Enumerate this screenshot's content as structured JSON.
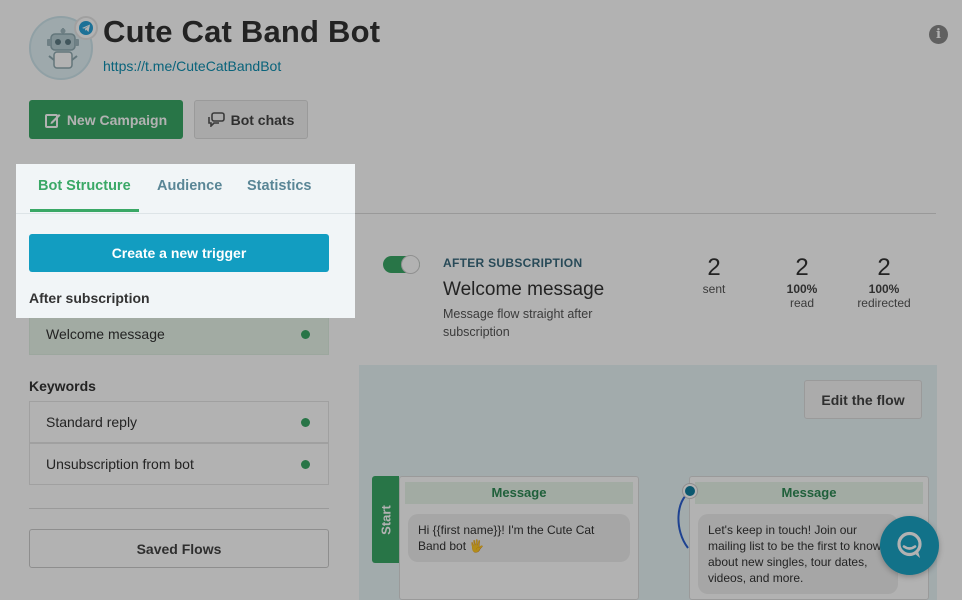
{
  "header": {
    "bot_name": "Cute Cat Band Bot",
    "bot_link": "https://t.me/CuteCatBandBot",
    "avatar_icon": "robot-icon",
    "badge_icon": "telegram-icon",
    "info_icon": "info-icon"
  },
  "actions": {
    "new_campaign": "New Campaign",
    "bot_chats": "Bot chats"
  },
  "tabs": [
    {
      "label": "Bot Structure",
      "active": true
    },
    {
      "label": "Audience",
      "active": false
    },
    {
      "label": "Statistics",
      "active": false
    }
  ],
  "sidebar": {
    "create_trigger": "Create a new trigger",
    "after_subscription_heading": "After subscription",
    "after_subscription_items": [
      {
        "label": "Welcome message",
        "active": true
      }
    ],
    "keywords_heading": "Keywords",
    "keyword_items": [
      {
        "label": "Standard reply"
      },
      {
        "label": "Unsubscription from bot"
      }
    ],
    "saved_flows": "Saved Flows"
  },
  "trigger_card": {
    "kicker": "AFTER SUBSCRIPTION",
    "title": "Welcome message",
    "description": "Message flow straight after subscription",
    "enabled": true,
    "stats": [
      {
        "value": "2",
        "percent": "",
        "label": "sent"
      },
      {
        "value": "2",
        "percent": "100%",
        "label": "read"
      },
      {
        "value": "2",
        "percent": "100%",
        "label": "redirected"
      }
    ]
  },
  "flow": {
    "edit_button": "Edit the flow",
    "start_label": "Start",
    "nodes": [
      {
        "header": "Message",
        "text": "Hi {{first  name}}! I'm the Cute Cat Band bot 🖐"
      },
      {
        "header": "Message",
        "text": "Let's keep in touch! Join our mailing list to be the first to know about new singles, tour dates, videos, and more."
      }
    ]
  },
  "colors": {
    "accent_green": "#3aa866",
    "accent_blue": "#129dc1",
    "link": "#0e8fb0"
  }
}
